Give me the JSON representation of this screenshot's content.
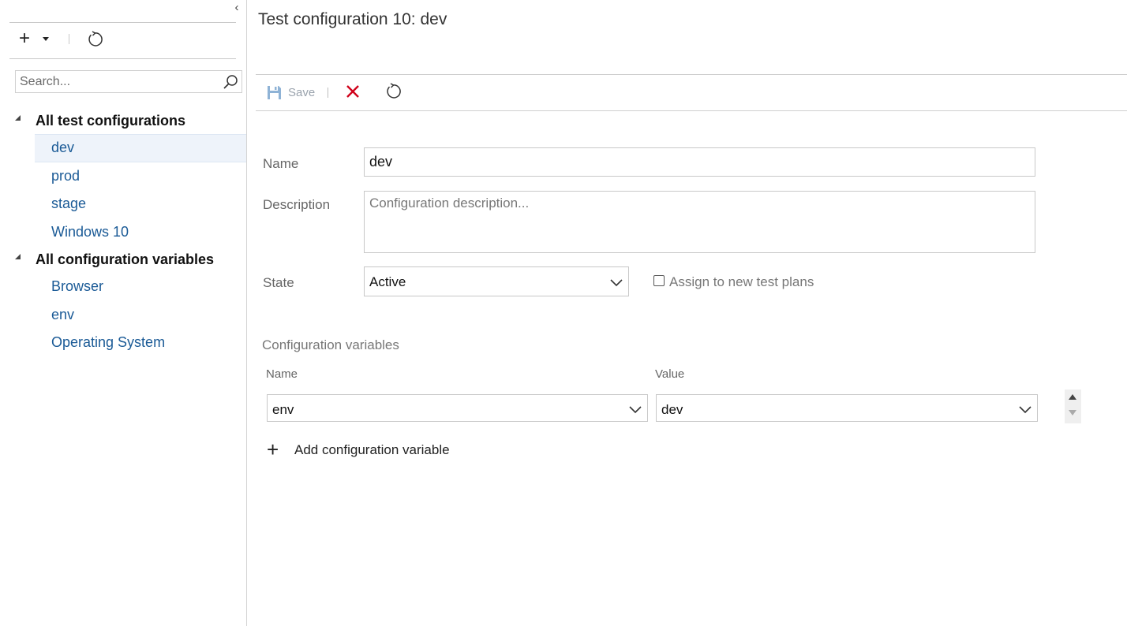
{
  "sidebar": {
    "search_placeholder": "Search...",
    "groups": [
      {
        "label": "All test configurations",
        "items": [
          "dev",
          "prod",
          "stage",
          "Windows 10"
        ],
        "selected": "dev"
      },
      {
        "label": "All configuration variables",
        "items": [
          "Browser",
          "env",
          "Operating System"
        ]
      }
    ]
  },
  "main": {
    "title": "Test configuration 10: dev",
    "toolbar": {
      "save_label": "Save"
    },
    "form": {
      "name_label": "Name",
      "name_value": "dev",
      "description_label": "Description",
      "description_placeholder": "Configuration description...",
      "state_label": "State",
      "state_value": "Active",
      "assign_label": "Assign to new test plans",
      "assign_checked": false
    },
    "variables": {
      "section_title": "Configuration variables",
      "name_header": "Name",
      "value_header": "Value",
      "rows": [
        {
          "name": "env",
          "value": "dev"
        }
      ],
      "add_label": "Add configuration variable"
    }
  },
  "colors": {
    "link": "#1a5a96",
    "selected_bg": "#eef3fa",
    "discard": "#d0021b",
    "save_disabled": "#9aa3ad"
  },
  "icons": [
    "collapse-icon",
    "add-icon",
    "chevron-down-icon",
    "refresh-icon",
    "search-icon",
    "save-icon",
    "close-icon",
    "plus-icon"
  ]
}
